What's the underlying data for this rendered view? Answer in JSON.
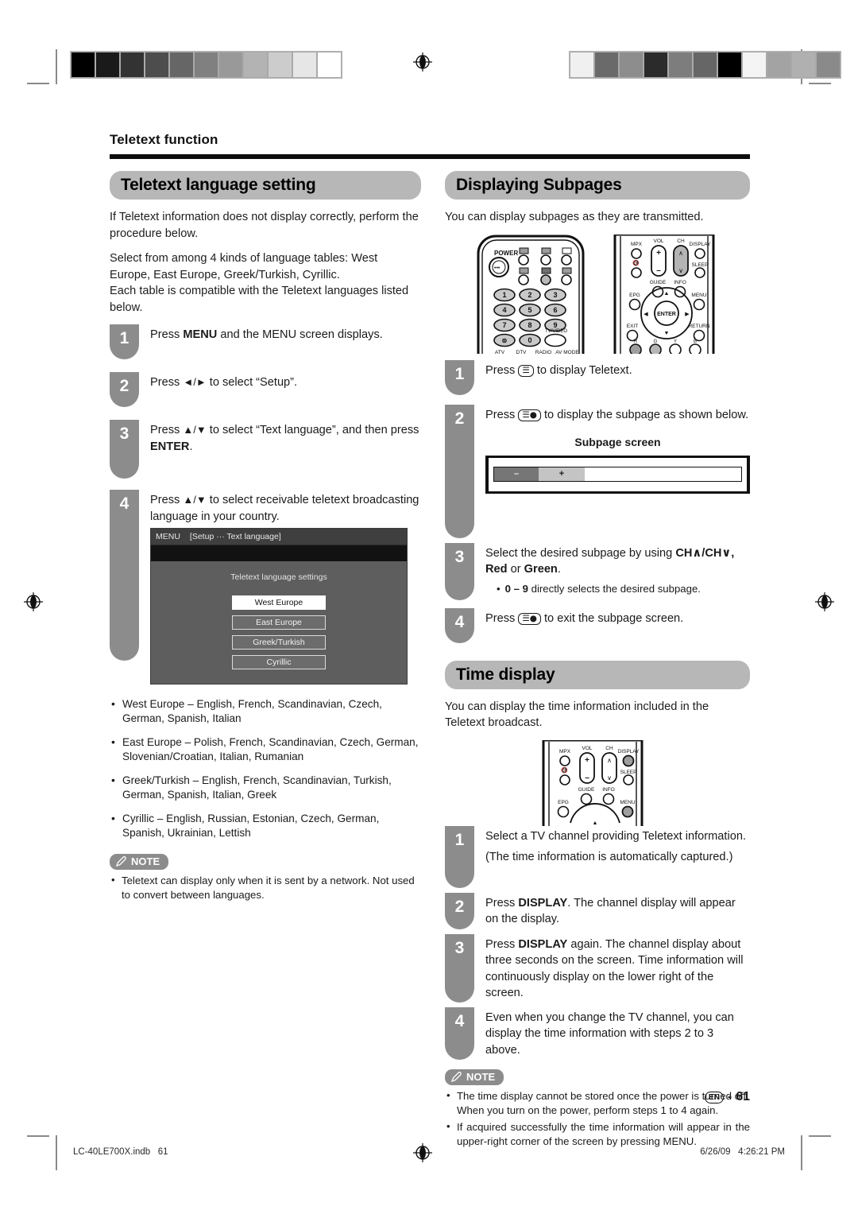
{
  "document": {
    "kicker": "Teletext function",
    "page_label": "61",
    "page_lang_badge": "EN",
    "page_separator": "-"
  },
  "left_column": {
    "heading": "Teletext language setting",
    "intro": [
      "If Teletext information does not display correctly, perform the procedure below.",
      "Select from among 4 kinds of language tables: West Europe, East Europe, Greek/Turkish, Cyrillic.",
      "Each table is compatible with the Teletext languages listed below."
    ],
    "steps": [
      {
        "number": "1",
        "text_pre": "Press ",
        "bold": "MENU",
        "text_post": " and the MENU screen displays."
      },
      {
        "number": "2",
        "text_pre": "Press ",
        "glyph": "◄/►",
        "text_post": " to select “Setup”."
      },
      {
        "number": "3",
        "text_pre": "Press ",
        "glyph": "▲/▼",
        "text_mid": " to select “Text language”, and then press ",
        "bold": "ENTER",
        "text_post": "."
      },
      {
        "number": "4",
        "text_pre": "Press ",
        "glyph": "▲/▼",
        "text_post": " to select receivable teletext broadcasting language in your country."
      }
    ],
    "osd": {
      "menu_label": "MENU",
      "breadcrumb": "[Setup ··· Text language]",
      "caption": "Teletext language settings",
      "options": [
        "West Europe",
        "East Europe",
        "Greek/Turkish",
        "Cyrillic"
      ],
      "selected_option": "West Europe"
    },
    "language_tables": [
      "West Europe – English, French, Scandinavian, Czech, German, Spanish, Italian",
      "East Europe – Polish, French, Scandinavian, Czech, German, Slovenian/Croatian, Italian, Rumanian",
      "Greek/Turkish – English, French, Scandinavian, Turkish, German, Spanish, Italian, Greek",
      "Cyrillic – English, Russian, Estonian, Czech, German, Spanish, Ukrainian, Lettish"
    ],
    "note": {
      "label": "NOTE",
      "items": [
        "Teletext can display only when it is sent by a network. Not used to convert between languages."
      ]
    }
  },
  "right_column": {
    "subpages": {
      "heading": "Displaying Subpages",
      "intro": "You can display subpages as they are transmitted.",
      "steps": [
        {
          "number": "1",
          "text_pre": "Press ",
          "glyph": "teletext-icon",
          "text_post": " to display Teletext."
        },
        {
          "number": "2",
          "text_pre": "Press ",
          "glyph": "subpage-icon",
          "text_post": " to display the subpage as shown below."
        },
        {
          "number": "3",
          "text_pre": "Select the desired subpage by using ",
          "bold": "CH∧/CH∨, Red",
          "text_mid": " or ",
          "bold2": "Green",
          "text_post": ".",
          "sub_bullet_bold": "0 – 9",
          "sub_bullet_rest": " directly selects the desired subpage."
        },
        {
          "number": "4",
          "text_pre": "Press ",
          "glyph": "subpage-icon",
          "text_post": " to exit the subpage screen."
        }
      ],
      "subpage_screen": {
        "title": "Subpage screen",
        "minus_label": "–",
        "plus_label": "+"
      }
    },
    "time_display": {
      "heading": "Time display",
      "intro": "You can display the time information included in the Teletext broadcast.",
      "steps": [
        {
          "number": "1",
          "text": "Select a TV channel providing Teletext information.",
          "text2": "(The time information is automatically captured.)"
        },
        {
          "number": "2",
          "text_pre": "Press ",
          "bold": "DISPLAY",
          "text_post": ". The channel display will appear on the display."
        },
        {
          "number": "3",
          "text_pre": "Press ",
          "bold": "DISPLAY",
          "text_post": " again. The channel display about three seconds on the screen. Time information will continuously display on the lower right of the screen."
        },
        {
          "number": "4",
          "text": "Even when you change the TV channel, you can display the time information with steps 2 to 3 above."
        }
      ],
      "note": {
        "label": "NOTE",
        "items": [
          "The time display cannot be stored once the power is turned off. When you turn on the power, perform steps 1 to 4 again.",
          "If acquired successfully the time information will appear in the upper-right corner of the screen by pressing MENU."
        ],
        "item2_bold_tail": "MENU"
      }
    }
  },
  "remote_full": {
    "power_label": "POWER",
    "numbers": [
      "1",
      "2",
      "3",
      "4",
      "5",
      "6",
      "7",
      "8",
      "9",
      "0"
    ],
    "tv_video_label": "TV/VIDEO",
    "source_labels": [
      "ATV",
      "DTV",
      "RADIO",
      "AV MODE"
    ],
    "right_labels": [
      "MPX",
      "VOL",
      "CH",
      "DISPLAY",
      "SLEEP",
      "GUIDE",
      "INFO",
      "EPG",
      "MENU",
      "ENTER",
      "EXIT",
      "RETURN"
    ],
    "color_keys": [
      "R",
      "G",
      "Y",
      "B"
    ]
  },
  "remote_small": {
    "labels": [
      "MPX",
      "VOL",
      "CH",
      "DISPLAY",
      "SLEEP",
      "GUIDE",
      "INFO",
      "EPG",
      "MENU"
    ],
    "highlighted": [
      "DISPLAY",
      "MENU"
    ]
  },
  "print_footer": {
    "file_name": "LC-40LE700X.indb",
    "file_page": "61",
    "timestamp_date": "6/26/09",
    "timestamp_time": "4:26:21 PM"
  },
  "calibration": {
    "left_strip": [
      "#000000",
      "#1a1a1a",
      "#333333",
      "#4d4d4d",
      "#666666",
      "#808080",
      "#999999",
      "#b3b3b3",
      "#cccccc",
      "#e6e6e6",
      "#ffffff"
    ],
    "right_strip": [
      "#f0f0f0",
      "#6a6a6a",
      "#8d8d8d",
      "#2b2b2b",
      "#7d7d7d",
      "#666666",
      "#000000",
      "#f4f4f4",
      "#a3a3a3",
      "#b0b0b0",
      "#8a8a8a"
    ]
  }
}
